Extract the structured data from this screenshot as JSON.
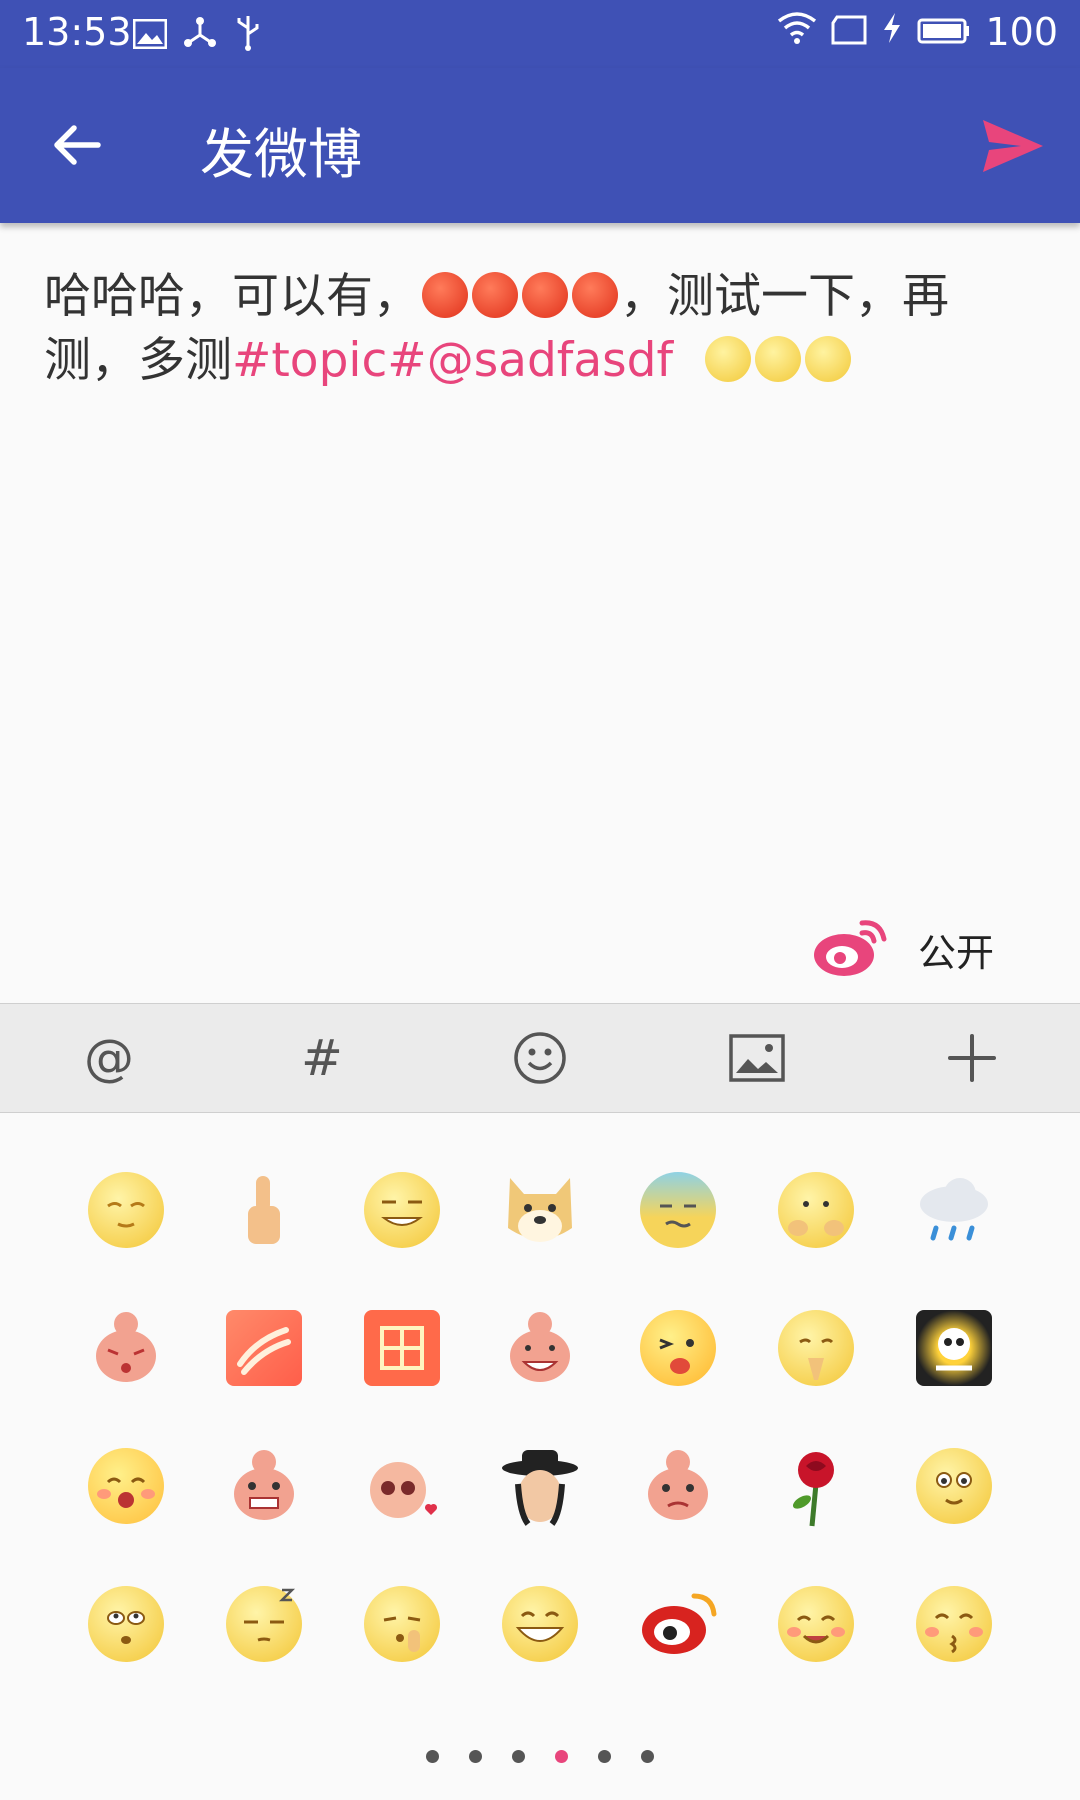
{
  "status_bar": {
    "time": "13:53",
    "battery": "100"
  },
  "app_bar": {
    "title": "发微博"
  },
  "compose": {
    "part1": "哈哈哈，可以有，",
    "part2": "，测试一下，再测，多测",
    "topic": "#topic#",
    "mention": "@sadfasdf"
  },
  "privacy": {
    "label": "公开"
  },
  "toolbar": {
    "at": "@",
    "hash": "#"
  },
  "emoji_grid": {
    "rows": [
      [
        "relieved",
        "thumbs-up",
        "smirk",
        "doge",
        "anxious",
        "shy",
        "rain-cloud"
      ],
      [
        "crying-bunny",
        "clap",
        "zan",
        "bunny-laugh",
        "wink-tongue",
        "pray",
        "skull"
      ],
      [
        "laughing",
        "bunny-grin",
        "bunny-heart",
        "hat-man",
        "bunny-confused",
        "rose",
        "blush"
      ],
      [
        "eye-roll",
        "sleepy",
        "shush",
        "big-grin",
        "weibo-logo",
        "smile",
        "kiss"
      ]
    ]
  },
  "pager": {
    "count": 6,
    "active_index": 3
  },
  "colors": {
    "primary": "#3f51b5",
    "accent": "#e8457c"
  }
}
